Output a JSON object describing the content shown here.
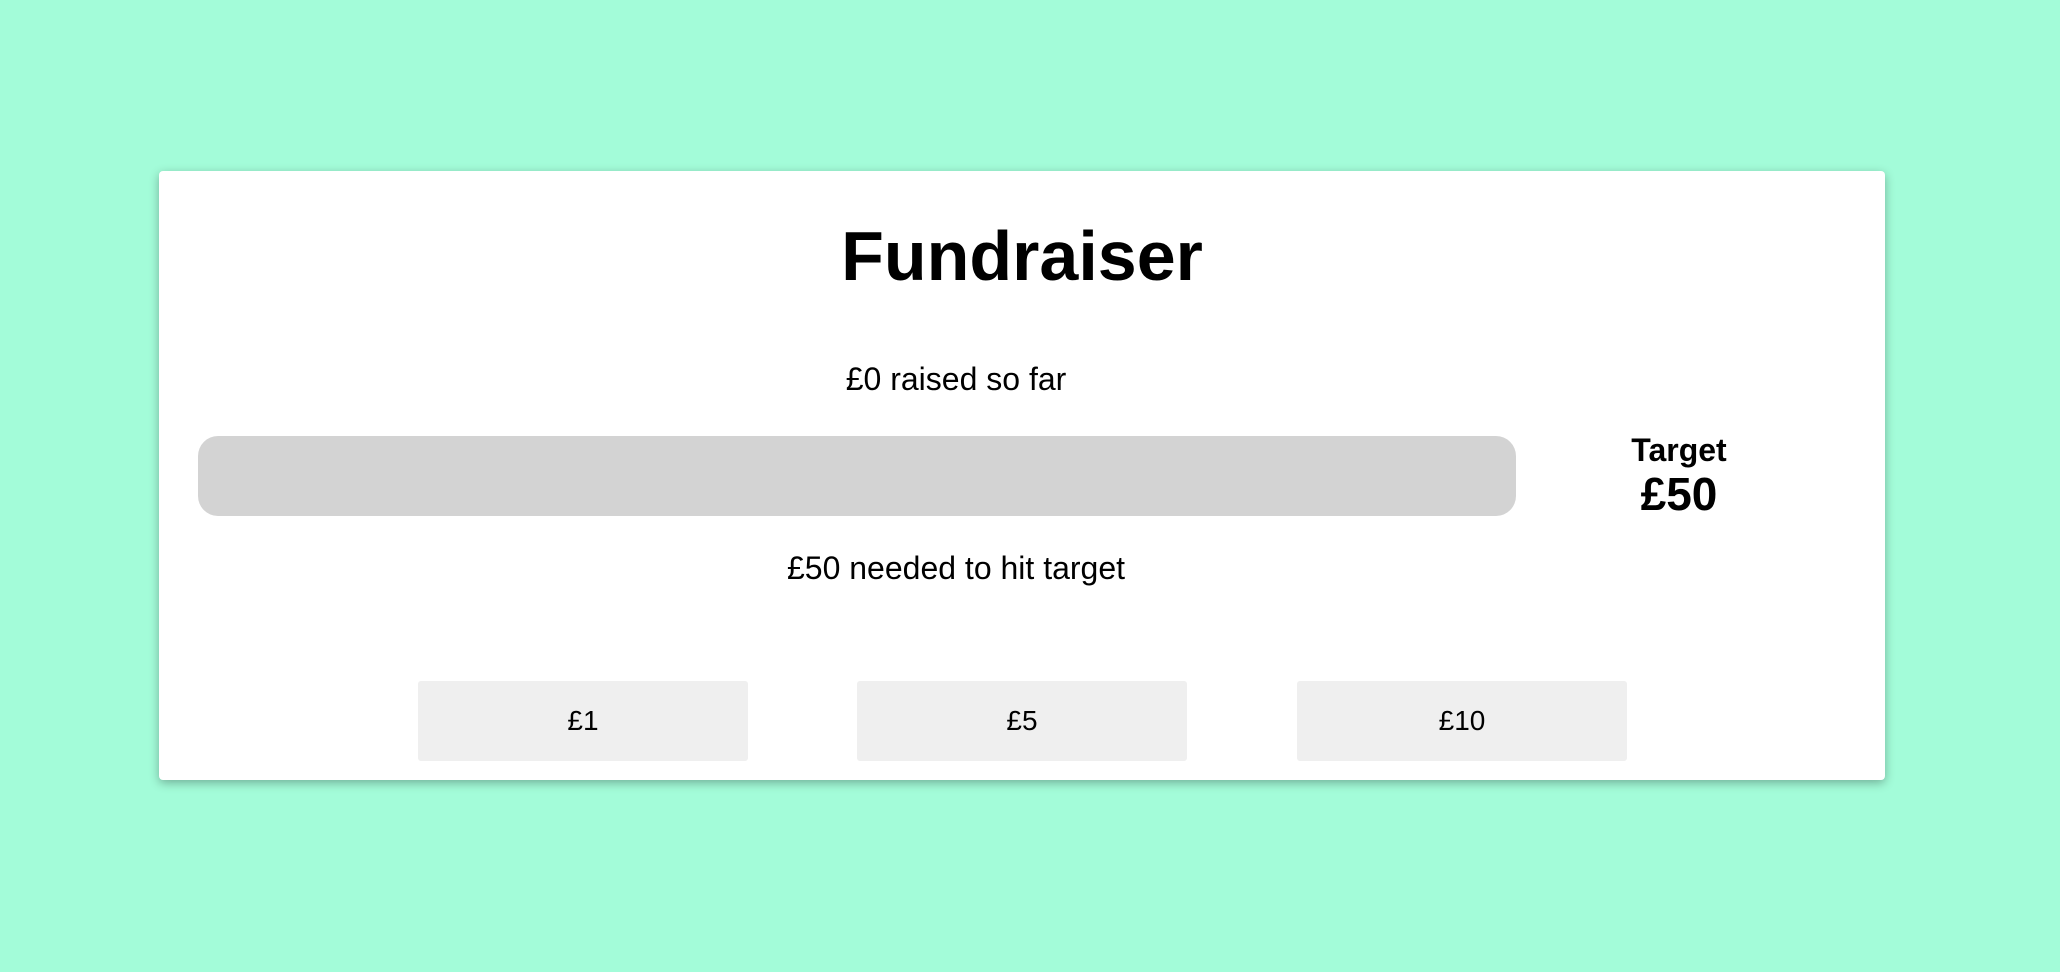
{
  "page": {
    "background_color": "#a3fcd9"
  },
  "card": {
    "title": "Fundraiser",
    "raised_text": "£0 raised so far",
    "needed_text": "£50 needed to hit target",
    "progress_percent": 0,
    "target": {
      "label": "Target",
      "value": "£50"
    },
    "donate_buttons": [
      {
        "label": "£1"
      },
      {
        "label": "£5"
      },
      {
        "label": "£10"
      }
    ]
  }
}
